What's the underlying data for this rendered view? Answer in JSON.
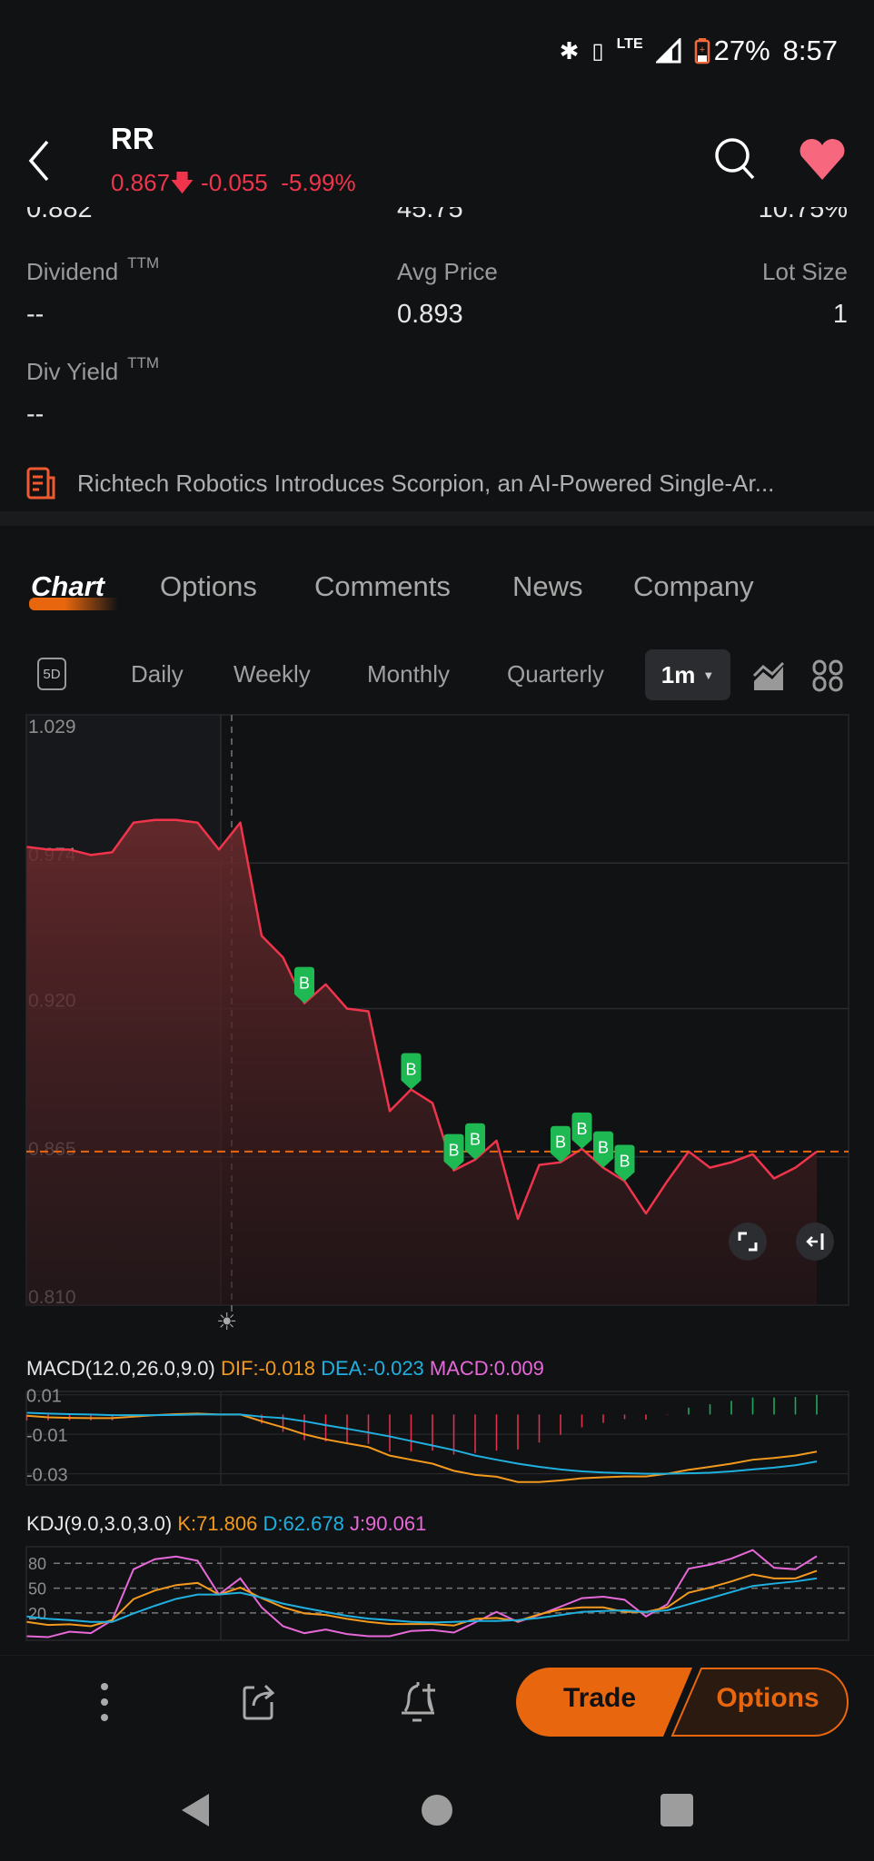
{
  "status_bar": {
    "lte": "LTE",
    "battery": "27%",
    "time": "8:57",
    "battery_color": "#f26a3c"
  },
  "header": {
    "symbol": "RR",
    "price": "0.867",
    "change": "-0.055",
    "change_pct": "-5.99%",
    "down_color": "#f0344c",
    "favorite_color": "#f7687f"
  },
  "stats_cropped": [
    "0.882",
    "45.75",
    "10.75%"
  ],
  "stats": [
    {
      "label": "Dividend",
      "sup": "TTM",
      "value": "--"
    },
    {
      "label": "Avg Price",
      "value": "0.893"
    },
    {
      "label": "Lot Size",
      "value": "1"
    },
    {
      "label": "Div Yield",
      "sup": "TTM",
      "value": "--"
    }
  ],
  "news": {
    "headline": "Richtech Robotics Introduces Scorpion, an AI-Powered Single-Ar..."
  },
  "tabs": [
    {
      "label": "Chart",
      "active": true
    },
    {
      "label": "Options"
    },
    {
      "label": "Comments"
    },
    {
      "label": "News"
    },
    {
      "label": "Company"
    }
  ],
  "periods": {
    "fiveday": "5D",
    "items": [
      "Daily",
      "Weekly",
      "Monthly",
      "Quarterly"
    ],
    "selected": "1m"
  },
  "accent": "#e8670e",
  "chart_data": [
    {
      "type": "area",
      "y_ticks": [
        "1.029",
        "0.974",
        "0.920",
        "0.865",
        "0.810"
      ],
      "ylim": [
        0.81,
        1.029
      ],
      "current_price_line": 0.867,
      "values": [
        0.98,
        0.979,
        0.979,
        0.977,
        0.978,
        0.989,
        0.99,
        0.99,
        0.989,
        0.979,
        0.989,
        0.947,
        0.939,
        0.922,
        0.929,
        0.92,
        0.919,
        0.882,
        0.89,
        0.885,
        0.86,
        0.864,
        0.871,
        0.842,
        0.862,
        0.863,
        0.868,
        0.861,
        0.856,
        0.844,
        0.856,
        0.867,
        0.861,
        0.863,
        0.866,
        0.857,
        0.861,
        0.867
      ],
      "buy_markers": {
        "label": "B",
        "indices": [
          13,
          18,
          20,
          21,
          25,
          26,
          27,
          28
        ],
        "color": "#1fb954"
      },
      "line_color": "#f0344c"
    },
    {
      "type": "macd",
      "title": "MACD(12.0,26.0,9.0)",
      "dif_label": "DIF:-0.018",
      "dea_label": "DEA:-0.023",
      "macd_label": "MACD:0.009",
      "y_ticks": [
        "0.01",
        "-0.01",
        "-0.03"
      ],
      "ylim": [
        -0.0357,
        0.0117
      ],
      "dif": [
        -0.0006,
        -0.0014,
        -0.0017,
        -0.0018,
        -0.0018,
        -0.0011,
        -0.0003,
        0.0002,
        0.0005,
        0,
        0,
        -0.0034,
        -0.0065,
        -0.01,
        -0.0126,
        -0.0146,
        -0.0165,
        -0.0208,
        -0.0229,
        -0.0249,
        -0.0285,
        -0.0306,
        -0.0315,
        -0.0342,
        -0.0342,
        -0.0334,
        -0.0323,
        -0.0318,
        -0.0314,
        -0.0314,
        -0.03,
        -0.028,
        -0.0265,
        -0.0249,
        -0.0229,
        -0.022,
        -0.0208,
        -0.0188
      ],
      "dea": [
        0.0009,
        0.0005,
        0.0002,
        0,
        -0.0003,
        -0.0003,
        -0.0003,
        -0.0002,
        0,
        0,
        0,
        -0.0011,
        -0.0018,
        -0.0034,
        -0.0054,
        -0.0072,
        -0.0091,
        -0.0111,
        -0.0134,
        -0.0157,
        -0.018,
        -0.0208,
        -0.0229,
        -0.0249,
        -0.0265,
        -0.0278,
        -0.0288,
        -0.0294,
        -0.0297,
        -0.03,
        -0.03,
        -0.0298,
        -0.0295,
        -0.0288,
        -0.0278,
        -0.0269,
        -0.0257,
        -0.0238
      ],
      "hist": [
        -0.003,
        -0.003,
        -0.003,
        -0.003,
        -0.003,
        -0.001,
        0.0002,
        0.0002,
        0.0002,
        0,
        0,
        -0.0046,
        -0.0088,
        -0.013,
        -0.0137,
        -0.0146,
        -0.0149,
        -0.0188,
        -0.0188,
        -0.0183,
        -0.0203,
        -0.0195,
        -0.0183,
        -0.0177,
        -0.0142,
        -0.0103,
        -0.0065,
        -0.0042,
        -0.0023,
        -0.0026,
        -0.0002,
        0.0035,
        0.0052,
        0.0069,
        0.0086,
        0.0086,
        0.0089,
        0.01
      ],
      "colors": {
        "dif": "#f39a1e",
        "dea": "#1fb0e0",
        "macd": "#e768d8",
        "up": "#1fa85a",
        "down": "#e0304a"
      }
    },
    {
      "type": "kdj",
      "title": "KDJ(9.0,3.0,3.0)",
      "k_label": "K:71.806",
      "d_label": "D:62.678",
      "j_label": "J:90.061",
      "y_ticks": [
        "80",
        "50",
        "20"
      ],
      "ylim": [
        -13,
        100
      ],
      "k": [
        9.2,
        5.5,
        6.3,
        4.0,
        11.4,
        36.8,
        47.1,
        53.7,
        56.3,
        42.3,
        50.7,
        37.9,
        26.8,
        19.5,
        17.6,
        12.9,
        9.2,
        6.6,
        6.6,
        6.6,
        4.8,
        12.9,
        14.0,
        10.3,
        18.4,
        24.3,
        26.8,
        26.8,
        21.3,
        21.3,
        26.8,
        44.5,
        50.7,
        58.1,
        66.5,
        61.8,
        61.8,
        71.0
      ],
      "d": [
        15.8,
        12.9,
        11.4,
        9.2,
        9.2,
        19.5,
        28.7,
        37.1,
        42.3,
        42.3,
        44.5,
        38.6,
        31.3,
        26.1,
        21.3,
        16.5,
        13.2,
        11.4,
        9.2,
        8.5,
        9.2,
        10.3,
        10.3,
        11.4,
        14.0,
        17.6,
        21.3,
        22.4,
        23.2,
        21.3,
        23.2,
        30.5,
        37.9,
        45.2,
        52.6,
        55.5,
        58.1,
        61.8
      ],
      "j": [
        -8.1,
        -9.2,
        -2.6,
        -4.4,
        11.4,
        72.8,
        84.9,
        88.2,
        83.1,
        42.3,
        61.8,
        26.8,
        4.0,
        -4.4,
        0,
        -5.5,
        -8.1,
        -8.1,
        -1.8,
        -0.7,
        -3.7,
        8.5,
        21.3,
        9.2,
        17.6,
        27.6,
        37.9,
        39.7,
        36.0,
        15.8,
        30.5,
        73.5,
        78.3,
        85.7,
        96.0,
        74.6,
        72.8,
        88.6
      ]
    }
  ],
  "bottom_bar": {
    "trade": "Trade",
    "options": "Options"
  }
}
